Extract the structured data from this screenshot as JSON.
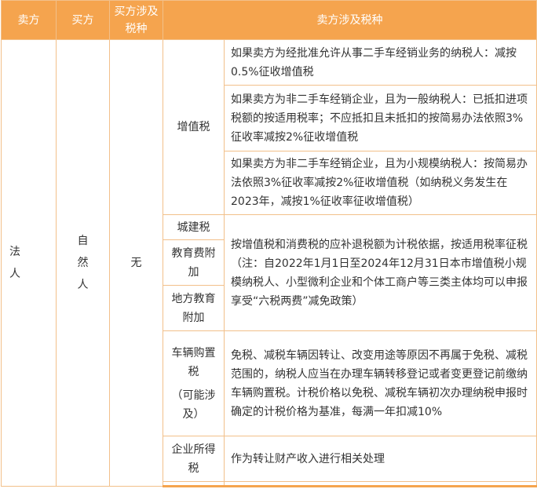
{
  "header": {
    "col1": "卖方",
    "col2": "买方",
    "col3": "买方涉及税种",
    "col4": "卖方涉及税种"
  },
  "row": {
    "seller": "法人",
    "buyer": "自然人",
    "buyer_tax": "无"
  },
  "taxes": {
    "vat_label": "增值税",
    "vat_desc_1": "如果卖方为经批准允许从事二手车经销业务的纳税人：减按0.5%征收增值税",
    "vat_desc_2": "如果卖方为非二手车经销企业，且为一般纳税人：已抵扣进项税额的按适用税率；不应抵扣且未抵扣的按简易办法依照3%征收率减按2%征收增值税",
    "vat_desc_3": "如果卖方为非二手车经销企业，且为小规模纳税人：按简易办法依照3%征收率减按2%征收增值税（如纳税义务发生在2023年，减按1%征收率征收增值税）",
    "city_label": "城建税",
    "edu_label": "教育费附加",
    "local_edu_label": "地方教育附加",
    "surcharge_desc": "按增值税和消费税的应补退税额为计税依据，按适用税率征税（注：自2022年1月1日至2024年12月31日本市增值税小规模纳税人、小型微利企业和个体工商户等三类主体均可以申报享受“六税两费”减免政策）",
    "vehicle_label": "车辆购置税",
    "vehicle_note": "（可能涉及）",
    "vehicle_desc": "免税、减税车辆因转让、改变用途等原因不再属于免税、减税范围的，纳税人应当在办理车辆转移登记或者变更登记前缴纳车辆购置税。计税价格以免税、减税车辆初次办理纳税申报时确定的计税价格为基准，每满一年扣减10%",
    "cit_label": "企业所得税",
    "cit_desc": "作为转让财产收入进行相关处理"
  },
  "colors": {
    "header_bg": "#f5a44e",
    "border": "#f2c08a"
  }
}
